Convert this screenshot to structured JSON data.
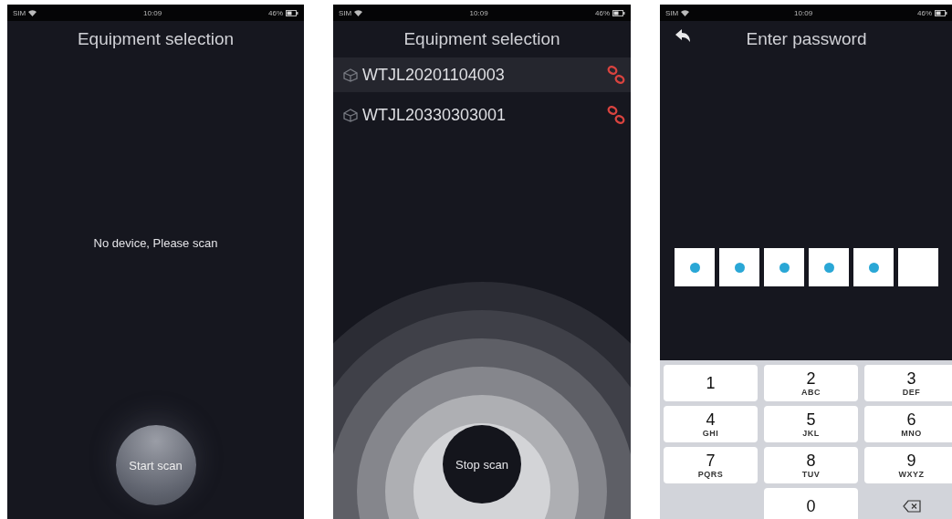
{
  "phones": [
    {
      "kind": "empty",
      "status_bar": {
        "carrier": "SIM",
        "time": "10:09",
        "battery": "46%"
      },
      "title": "Equipment selection",
      "message": "No device, Please scan",
      "button": "Start scan"
    },
    {
      "kind": "scanning",
      "status_bar": {
        "carrier": "SIM",
        "time": "10:09",
        "battery": "46%"
      },
      "title": "Equipment selection",
      "devices": [
        {
          "name": "WTJL20201104003",
          "selected": true
        },
        {
          "name": "WTJL20330303001",
          "selected": false
        }
      ],
      "button": "Stop scan"
    },
    {
      "kind": "password",
      "status_bar": {
        "carrier": "SIM",
        "time": "10:09",
        "battery": "46%"
      },
      "title": "Enter password",
      "digits": [
        {
          "filled": true
        },
        {
          "filled": true
        },
        {
          "filled": true
        },
        {
          "filled": true
        },
        {
          "filled": true
        },
        {
          "filled": false
        }
      ],
      "keys": [
        {
          "kind": "digit",
          "digit": "1"
        },
        {
          "kind": "digit",
          "digit": "2",
          "letters": "ABC"
        },
        {
          "kind": "digit",
          "digit": "3",
          "letters": "DEF"
        },
        {
          "kind": "digit",
          "digit": "4",
          "letters": "GHI"
        },
        {
          "kind": "digit",
          "digit": "5",
          "letters": "JKL"
        },
        {
          "kind": "digit",
          "digit": "6",
          "letters": "MNO"
        },
        {
          "kind": "digit",
          "digit": "7",
          "letters": "PQRS"
        },
        {
          "kind": "digit",
          "digit": "8",
          "letters": "TUV"
        },
        {
          "kind": "digit",
          "digit": "9",
          "letters": "WXYZ"
        },
        {
          "kind": "blank"
        },
        {
          "kind": "digit",
          "digit": "0"
        },
        {
          "kind": "delete"
        }
      ]
    }
  ]
}
